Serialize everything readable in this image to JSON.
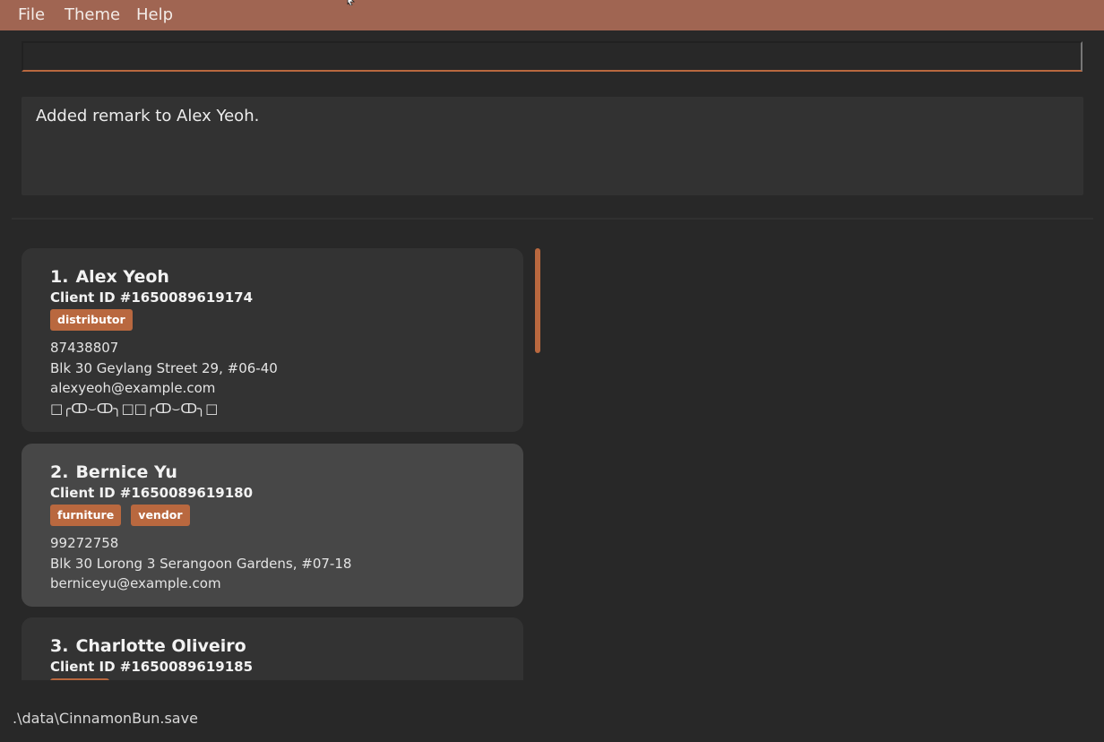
{
  "menu": {
    "file": "File",
    "theme": "Theme",
    "help": "Help"
  },
  "command": {
    "value": "",
    "placeholder": ""
  },
  "result": {
    "message": "Added remark to Alex Yeoh."
  },
  "clients": [
    {
      "index": "1.",
      "name": "Alex Yeoh",
      "client_id": "Client ID #1650089619174",
      "tags": [
        "distributor"
      ],
      "phone": "87438807",
      "address": "Blk 30 Geylang Street 29, #06-40",
      "email": "alexyeoh@example.com",
      "remark": "□╭ↀ⌣ↀ╮□□╭ↀ⌣ↀ╮□"
    },
    {
      "index": "2.",
      "name": "Bernice Yu",
      "client_id": "Client ID #1650089619180",
      "tags": [
        "furniture",
        "vendor"
      ],
      "phone": "99272758",
      "address": "Blk 30 Lorong 3 Serangoon Gardens, #07-18",
      "email": "berniceyu@example.com"
    },
    {
      "index": "3.",
      "name": "Charlotte Oliveiro",
      "client_id": "Client ID #1650089619185",
      "tags": [
        ""
      ]
    }
  ],
  "status": {
    "save_path": ".\\data\\CinnamonBun.save"
  },
  "colors": {
    "menubar": "#a06552",
    "accent": "#b9683f",
    "background": "#282828",
    "card": "#333333",
    "card_selected": "#474747"
  }
}
